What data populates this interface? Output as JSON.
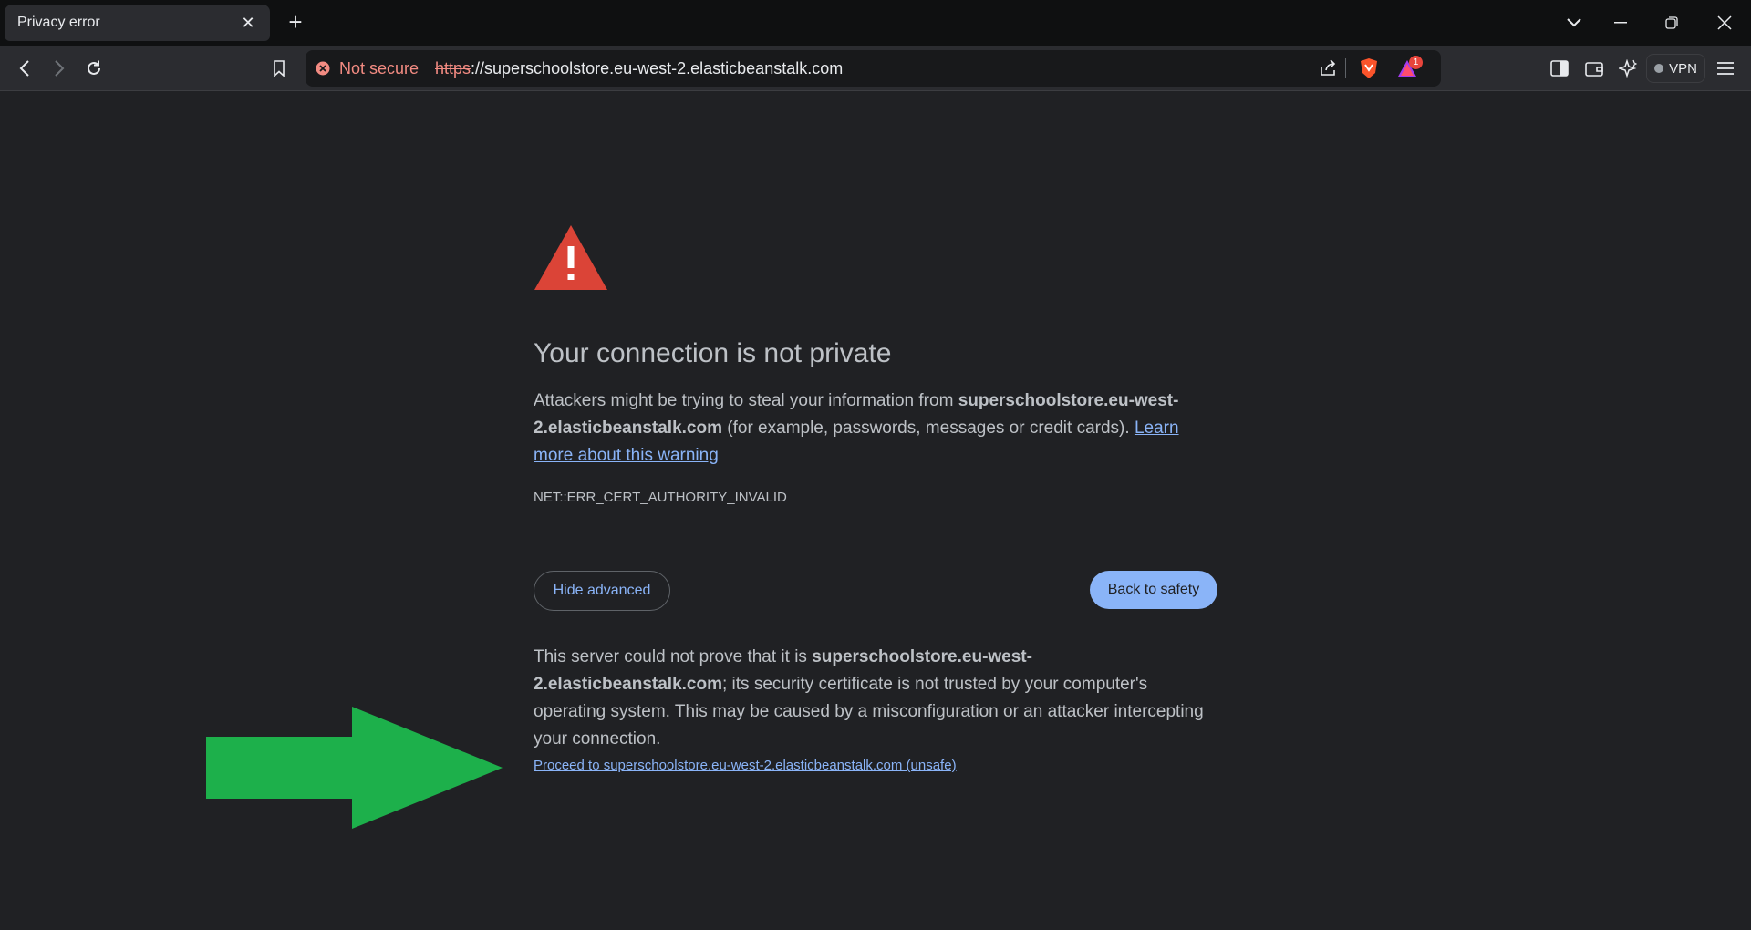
{
  "tab": {
    "title": "Privacy error",
    "close_glyph": "✕"
  },
  "toolbar": {
    "security_label": "Not secure",
    "url_scheme": "https",
    "url_rest": "://superschoolstore.eu-west-2.elasticbeanstalk.com",
    "notification_count": "1",
    "vpn_label": "VPN"
  },
  "page": {
    "heading": "Your connection is not private",
    "intro_before": "Attackers might be trying to steal your information from ",
    "intro_host": "superschoolstore.eu-west-2.elasticbeanstalk.com",
    "intro_after": " (for example, passwords, messages or credit cards). ",
    "learn_more": "Learn more about this warning",
    "error_code": "NET::ERR_CERT_AUTHORITY_INVALID",
    "hide_advanced": "Hide advanced",
    "back_to_safety": "Back to safety",
    "detail_before": "This server could not prove that it is ",
    "detail_host": "superschoolstore.eu-west-2.elasticbeanstalk.com",
    "detail_after": "; its security certificate is not trusted by your computer's operating system. This may be caused by a misconfiguration or an attacker intercepting your connection.",
    "proceed_link": "Proceed to superschoolstore.eu-west-2.elasticbeanstalk.com (unsafe)"
  },
  "colors": {
    "background": "#202124",
    "link": "#8ab4f8",
    "warning_red": "#db4437",
    "arrow_green": "#1db04b"
  },
  "icons": [
    "back-icon",
    "forward-icon",
    "reload-icon",
    "bookmark-icon",
    "share-icon",
    "brave-shield-icon",
    "brave-rewards-icon",
    "sidebar-icon",
    "wallet-icon",
    "leo-ai-icon",
    "menu-icon",
    "warning-triangle-icon",
    "green-arrow-annotation"
  ]
}
